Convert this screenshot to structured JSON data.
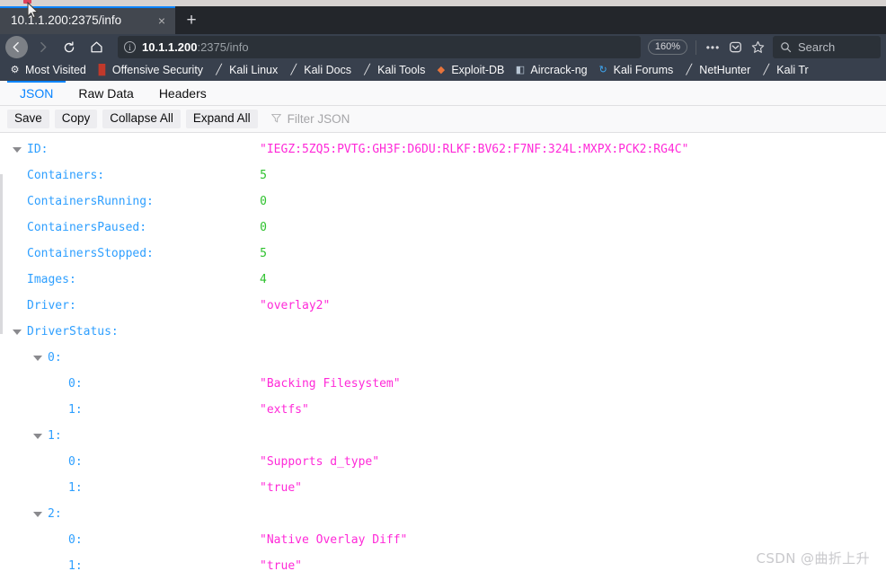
{
  "browser": {
    "tab": {
      "title": "10.1.1.200:2375/info",
      "close_label": "×"
    },
    "newtab_label": "+",
    "nav": {
      "back_icon": "←",
      "forward_icon": "→",
      "reload_icon": "⟳",
      "home_icon": "⌂"
    },
    "urlbar": {
      "info_icon": "i",
      "host": "10.1.1.200",
      "rest": ":2375/info",
      "full": "10.1.1.200:2375/info"
    },
    "zoom_level": "160%",
    "page_actions": {
      "more_label": "•••",
      "pocket_label": "pocket-icon",
      "bookmark_star_label": "☆"
    },
    "search": {
      "icon": "search-icon",
      "placeholder": "Search"
    },
    "bookmarks": [
      {
        "label": "Most Visited",
        "icon": "⚙",
        "icon_color": "#f2f2f4"
      },
      {
        "label": "Offensive Security",
        "icon": "▐▌",
        "icon_color": "#c0392b"
      },
      {
        "label": "Kali Linux",
        "icon": "╱",
        "icon_color": "#e8e8ea"
      },
      {
        "label": "Kali Docs",
        "icon": "╱",
        "icon_color": "#e8e8ea"
      },
      {
        "label": "Kali Tools",
        "icon": "╱",
        "icon_color": "#e8e8ea"
      },
      {
        "label": "Exploit-DB",
        "icon": "◆",
        "icon_color": "#e8743b"
      },
      {
        "label": "Aircrack-ng",
        "icon": "◧",
        "icon_color": "#b8c6d4"
      },
      {
        "label": "Kali Forums",
        "icon": "↻",
        "icon_color": "#3fa9f5"
      },
      {
        "label": "NetHunter",
        "icon": "╱",
        "icon_color": "#e8e8ea"
      },
      {
        "label": "Kali Tr",
        "icon": "╱",
        "icon_color": "#e8e8ea"
      }
    ]
  },
  "viewer": {
    "tabs": [
      {
        "label": "JSON",
        "active": true
      },
      {
        "label": "Raw Data",
        "active": false
      },
      {
        "label": "Headers",
        "active": false
      }
    ],
    "toolbar": {
      "save_label": "Save",
      "copy_label": "Copy",
      "collapse_all_label": "Collapse All",
      "expand_all_label": "Expand All",
      "filter_icon": "filter-icon",
      "filter_placeholder": "Filter JSON"
    },
    "rows": [
      {
        "indent": 0,
        "twisty": true,
        "key": "ID:",
        "value": "\"IEGZ:5ZQ5:PVTG:GH3F:D6DU:RLKF:BV62:F7NF:324L:MXPX:PCK2:RG4C\"",
        "type": "string"
      },
      {
        "indent": 0,
        "twisty": false,
        "key": "Containers:",
        "value": "5",
        "type": "number"
      },
      {
        "indent": 0,
        "twisty": false,
        "key": "ContainersRunning:",
        "value": "0",
        "type": "number"
      },
      {
        "indent": 0,
        "twisty": false,
        "key": "ContainersPaused:",
        "value": "0",
        "type": "number"
      },
      {
        "indent": 0,
        "twisty": false,
        "key": "ContainersStopped:",
        "value": "5",
        "type": "number"
      },
      {
        "indent": 0,
        "twisty": false,
        "key": "Images:",
        "value": "4",
        "type": "number"
      },
      {
        "indent": 0,
        "twisty": false,
        "key": "Driver:",
        "value": "\"overlay2\"",
        "type": "string"
      },
      {
        "indent": 0,
        "twisty": true,
        "key": "DriverStatus:",
        "value": "",
        "type": "none"
      },
      {
        "indent": 1,
        "twisty": true,
        "key": "0:",
        "value": "",
        "type": "none"
      },
      {
        "indent": 2,
        "twisty": false,
        "key": "0:",
        "value": "\"Backing Filesystem\"",
        "type": "string"
      },
      {
        "indent": 2,
        "twisty": false,
        "key": "1:",
        "value": "\"extfs\"",
        "type": "string"
      },
      {
        "indent": 1,
        "twisty": true,
        "key": "1:",
        "value": "",
        "type": "none"
      },
      {
        "indent": 2,
        "twisty": false,
        "key": "0:",
        "value": "\"Supports d_type\"",
        "type": "string"
      },
      {
        "indent": 2,
        "twisty": false,
        "key": "1:",
        "value": "\"true\"",
        "type": "string"
      },
      {
        "indent": 1,
        "twisty": true,
        "key": "2:",
        "value": "",
        "type": "none"
      },
      {
        "indent": 2,
        "twisty": false,
        "key": "0:",
        "value": "\"Native Overlay Diff\"",
        "type": "string"
      },
      {
        "indent": 2,
        "twisty": false,
        "key": "1:",
        "value": "\"true\"",
        "type": "string"
      }
    ]
  },
  "watermark": "CSDN @曲折上升"
}
